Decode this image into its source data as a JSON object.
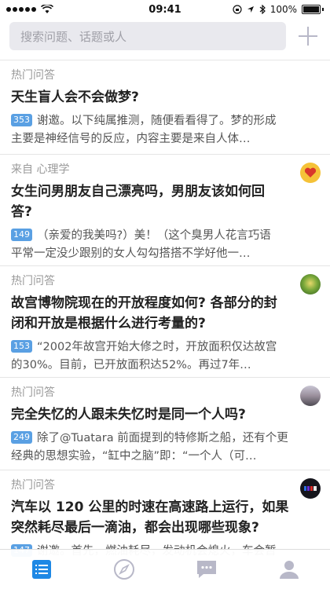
{
  "status_bar": {
    "time": "09:41",
    "battery_percent": "100%"
  },
  "search": {
    "placeholder": "搜索问题、话题或人"
  },
  "feed": [
    {
      "source": "热门问答",
      "title": "天生盲人会不会做梦?",
      "votes": "353",
      "excerpt_line1": "谢邀。以下纯属推测，随便看看得了。梦的形成",
      "excerpt_line2": "主要是神经信号的反应，内容主要是来自人体…",
      "avatar_icon": "heart-avatar-icon"
    },
    {
      "source": "来自 心理学",
      "title_line1": "女生问男朋友自己漂亮吗，男朋友该如何回",
      "title_line2": "答?",
      "votes": "149",
      "excerpt_line1": "（亲爱的我美吗?）美！（这个臭男人花言巧语",
      "excerpt_line2": "平常一定没少跟别的女人勾勾搭搭不学好他一…",
      "avatar_icon": "heart-avatar-icon"
    },
    {
      "source": "热门问答",
      "title_line1": "故宫博物院现在的开放程度如何? 各部分的封",
      "title_line2": "闭和开放是根据什么进行考量的?",
      "votes": "153",
      "excerpt_line1": "“2002年故宫开始大修之时，开放面积仅达故宫",
      "excerpt_line2": "的30%。目前，已开放面积达52%。再过7年…",
      "avatar_icon": "user-avatar-icon"
    },
    {
      "source": "热门问答",
      "title": "完全失忆的人跟未失忆时是同一个人吗?",
      "votes": "249",
      "excerpt_line1": "除了@Tuatara 前面提到的特修斯之船，还有个更",
      "excerpt_line2": "经典的思想实验，“缸中之脑”即：“一个人（可…",
      "avatar_icon": "user-avatar-icon"
    },
    {
      "source": "热门问答",
      "title_line1": "汽车以 120 公里的时速在高速路上运行，如果",
      "title_line2": "突然耗尽最后一滴油，都会出现哪些现象?",
      "votes": "147",
      "excerpt_line1": "谢邀。首先，燃油耗尽，发动机会熄火，车会暂",
      "avatar_icon": "user-avatar-icon"
    }
  ],
  "tab_bar": {
    "tabs": [
      {
        "icon": "feed-list-icon",
        "active": true
      },
      {
        "icon": "compass-icon",
        "active": false
      },
      {
        "icon": "message-icon",
        "active": false
      },
      {
        "icon": "profile-icon",
        "active": false
      }
    ]
  },
  "colors": {
    "accent": "#1e88e5",
    "vote_badge": "#5aa0e3",
    "inactive_tab": "#b8b8c8"
  }
}
